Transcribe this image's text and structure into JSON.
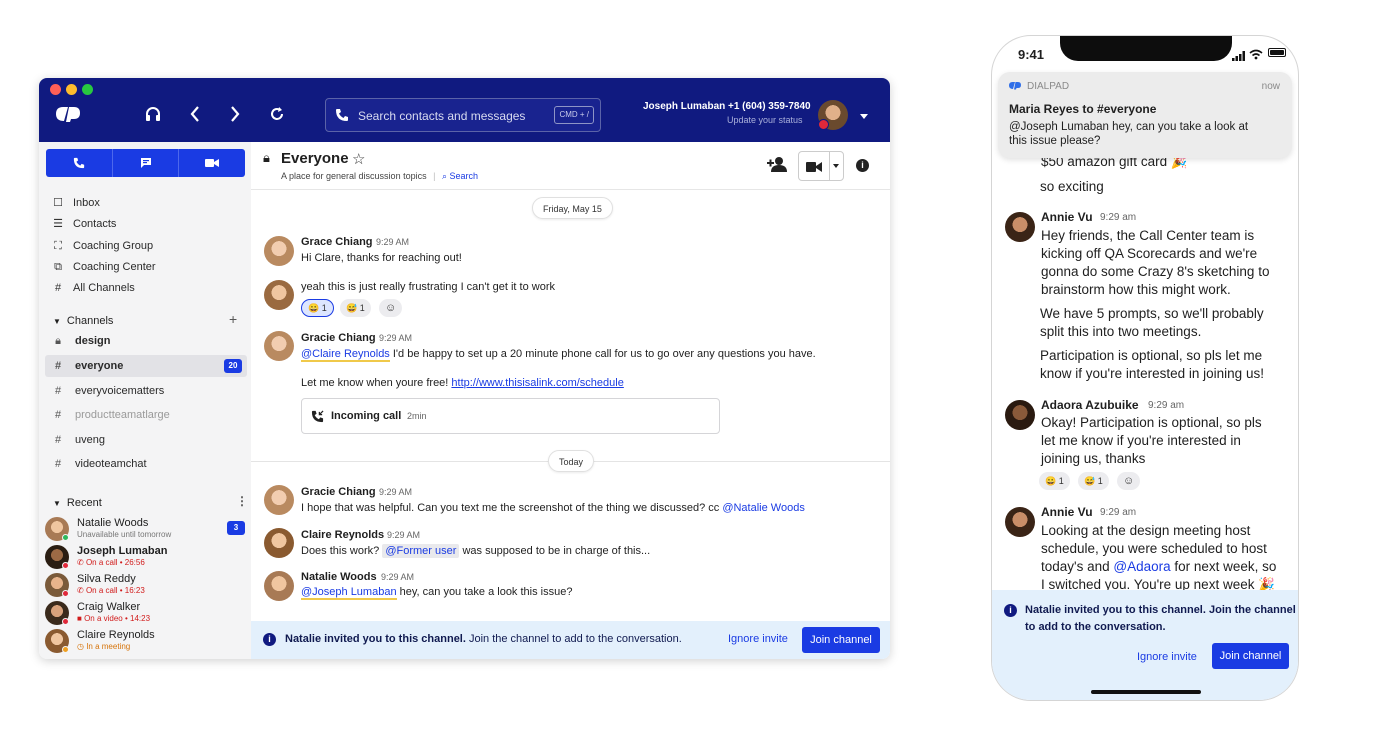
{
  "desktop": {
    "topbar": {
      "search_placeholder": "Search contacts and messages",
      "shortcut": "CMD + /",
      "user_name": "Joseph Lumaban",
      "user_phone": "+1 (604) 359-7840",
      "user_status": "Update your status"
    },
    "sidebar": {
      "nav": [
        {
          "label": "Inbox",
          "icon": "inbox-icon"
        },
        {
          "label": "Contacts",
          "icon": "contacts-icon"
        },
        {
          "label": "Coaching Group",
          "icon": "coaching-group-icon"
        },
        {
          "label": "Coaching Center",
          "icon": "coaching-center-icon"
        },
        {
          "label": "All Channels",
          "icon": "hash-icon"
        }
      ],
      "channels_title": "Channels",
      "channels": [
        {
          "label": "design",
          "icon": "lock-icon"
        },
        {
          "label": "everyone",
          "icon": "hash-icon",
          "badge": "20"
        },
        {
          "label": "everyvoicematters",
          "icon": "hash-icon"
        },
        {
          "label": "productteamatlarge",
          "icon": "hash-icon"
        },
        {
          "label": "uveng",
          "icon": "hash-icon"
        },
        {
          "label": "videoteamchat",
          "icon": "hash-icon"
        }
      ],
      "recent_title": "Recent",
      "recent": [
        {
          "name": "Natalie Woods",
          "status": "Unavailable until tomorrow",
          "badge": "3"
        },
        {
          "name": "Joseph Lumaban",
          "status": "On a call • 26:56"
        },
        {
          "name": "Silva Reddy",
          "status": "On a call • 16:23"
        },
        {
          "name": "Craig Walker",
          "status": "On a video • 14:23"
        },
        {
          "name": "Claire Reynolds",
          "status": "In a meeting"
        }
      ]
    },
    "channel": {
      "title": "Everyone",
      "description": "A place for general discussion topics",
      "search_label": "Search"
    },
    "messages": {
      "date1": "Friday, May 15",
      "m1_name": "Grace Chiang",
      "m1_time": "9:29 AM",
      "m1_text": "Hi Clare, thanks for reaching out!",
      "m2_text": "yeah this is just really frustrating I can't get it to work",
      "m2_react1": "😀 1",
      "m2_react2": "😅 1",
      "m3_name": "Gracie Chiang",
      "m3_time": "9:29 AM",
      "m3_mention": "@Claire Reynolds",
      "m3_text": " I'd be happy to set up a 20 minute phone call for us to go over any questions you have.",
      "m3_text2": "Let me know when youre free! ",
      "m3_link": "http://www.thisisalink.com/schedule",
      "call_label": "Incoming call",
      "call_duration": "2min",
      "date2": "Today",
      "m4_name": "Gracie Chiang",
      "m4_time": "9:29 AM",
      "m4_text": "I hope that was helpful. Can you text me the screenshot of the thing we discussed? cc ",
      "m4_mention": "@Natalie Woods",
      "m5_name": "Claire Reynolds",
      "m5_time": "9:29 AM",
      "m5_text": "Does this work? ",
      "m5_mention": "@Former user",
      "m5_text2": " was supposed to be in charge of this...",
      "m6_name": "Natalie Woods",
      "m6_time": "9:29 AM",
      "m6_mention": "@Joseph Lumaban",
      "m6_text": " hey, can you take a look this issue?"
    },
    "invite": {
      "bold": "Natalie invited you to this channel.",
      "rest": " Join the channel to add to the conversation.",
      "ignore": "Ignore invite",
      "join": "Join channel"
    }
  },
  "phone": {
    "time": "9:41",
    "notif_app": "DIALPAD",
    "notif_time": "now",
    "notif_title": "Maria Reyes to #everyone",
    "notif_body1": "@Joseph Lumaban hey, can you take a look at",
    "notif_body2": "this issue please?",
    "l1": "$50 amazon gift card 🎉",
    "l2": "so exciting",
    "a1_name": "Annie Vu",
    "a1_time": "9:29 am",
    "a1_l1": "Hey friends, the Call Center team is",
    "a1_l2": "kicking off QA Scorecards and we're",
    "a1_l3": "gonna do some Crazy 8's sketching to",
    "a1_l4": "brainstorm how this might work.",
    "a1_l5": "We have 5 prompts, so we'll probably",
    "a1_l6": "split this into two meetings.",
    "a1_l7": "Participation is optional, so pls let me",
    "a1_l8": "know if you're interested in joining us!",
    "a2_name": "Adaora Azubuike",
    "a2_time": "9:29 am",
    "a2_l1": "Okay! Participation is optional, so pls",
    "a2_l2": "let me know if you're interested in",
    "a2_l3": "joining us, thanks",
    "a2_react1": "😀 1",
    "a2_react2": "😅 1",
    "a3_name": "Annie Vu",
    "a3_time": "9:29 am",
    "a3_l1": "Looking at the design meeting host",
    "a3_l2": "schedule, you were scheduled to host",
    "a3_l3a": "today's and ",
    "a3_mention": "@Adaora",
    "a3_l3b": " for next week, so",
    "a3_l4": "I switched you. You're up next week 🎉",
    "invite_l1": "Natalie invited you to this channel. Join the channel",
    "invite_l2": "to add to the conversation.",
    "ignore": "Ignore invite",
    "join": "Join channel"
  },
  "colors": {
    "brand_navy": "#101a80",
    "accent_blue": "#1a3be3",
    "invite_bg": "#e3f0fc"
  }
}
